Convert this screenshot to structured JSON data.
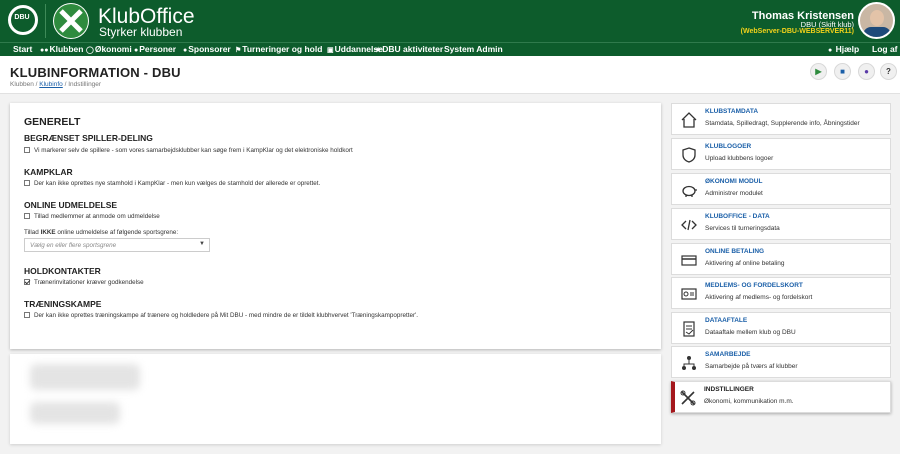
{
  "header": {
    "brand": "KlubOffice",
    "tagline": "Styrker klubben",
    "dbu_logo_text": "DBU",
    "user_name": "Thomas Kristensen",
    "user_club": "DBU (Skift klub)",
    "server": "(WebServer-DBU-WEBSERVER11)"
  },
  "nav": {
    "items": [
      {
        "label": "Start",
        "icon": ""
      },
      {
        "label": "Klubben",
        "icon": "group-icon"
      },
      {
        "label": "Økonomi",
        "icon": "coin-icon"
      },
      {
        "label": "Personer",
        "icon": "person-icon"
      },
      {
        "label": "Sponsorer",
        "icon": "sponsor-icon"
      },
      {
        "label": "Turneringer og hold",
        "icon": "flag-icon"
      },
      {
        "label": "Uddannelse",
        "icon": "book-icon"
      },
      {
        "label": "DBU aktiviteter",
        "icon": "star-icon"
      },
      {
        "label": "System Admin",
        "icon": ""
      }
    ],
    "help": "Hjælp",
    "logout": "Log af"
  },
  "page": {
    "title": "KLUBINFORMATION - DBU",
    "breadcrumb": [
      "Klubben",
      "Klubinfo",
      "Indstillinger"
    ]
  },
  "panel": {
    "title": "GENERELT",
    "sections": [
      {
        "title": "BEGRÆNSET SPILLER-DELING",
        "checkboxes": [
          {
            "label": "Vi markerer selv de spillere - som vores samarbejdsklubber kan søge frem i KampKlar og det elektroniske holdkort",
            "checked": false
          }
        ]
      },
      {
        "title": "KAMPKLAR",
        "checkboxes": [
          {
            "label": "Der kan ikke oprettes nye stamhold i KampKlar - men kun vælges de stamhold der allerede er oprettet.",
            "checked": false
          }
        ]
      },
      {
        "title": "ONLINE UDMELDELSE",
        "checkboxes": [
          {
            "label": "Tillad medlemmer at anmode om udmeldelse",
            "checked": false
          }
        ]
      },
      {
        "title": "HOLDKONTAKTER",
        "checkboxes": [
          {
            "label": "Trænerinvitationer kræver godkendelse",
            "checked": true
          }
        ]
      },
      {
        "title": "TRÆNINGSKAMPE",
        "checkboxes": [
          {
            "label": "Der kan ikke oprettes træningskampe af trænere og holdledere på Mit DBU - med mindre de er tildelt klubhvervet 'Træningskampopretter'.",
            "checked": false
          }
        ]
      }
    ],
    "sport_label_pre": "Tillad ",
    "sport_label_bold": "IKKE",
    "sport_label_post": " online udmeldelse af følgende sportsgrene:",
    "sport_placeholder": "Vælg en eller flere sportsgrene"
  },
  "cards": [
    {
      "title": "KLUBSTAMDATA",
      "desc": "Stamdata, Spilledragt, Supplerende info, Åbningstider",
      "icon": "home-icon",
      "active": false
    },
    {
      "title": "KLUBLOGOER",
      "desc": "Upload klubbens logoer",
      "icon": "shield-icon",
      "active": false
    },
    {
      "title": "ØKONOMI MODUL",
      "desc": "Administrer modulet",
      "icon": "piggy-bank-icon",
      "active": false
    },
    {
      "title": "KLUBOFFICE - DATA",
      "desc": "Services til turneringsdata",
      "icon": "code-icon",
      "active": false
    },
    {
      "title": "ONLINE BETALING",
      "desc": "Aktivering af online betaling",
      "icon": "credit-card-icon",
      "active": false
    },
    {
      "title": "MEDLEMS- OG FORDELSKORT",
      "desc": "Aktivering af medlems- og fordelskort",
      "icon": "id-card-icon",
      "active": false
    },
    {
      "title": "DATAAFTALE",
      "desc": "Dataaftale mellem klub og DBU",
      "icon": "contract-icon",
      "active": false
    },
    {
      "title": "SAMARBEJDE",
      "desc": "Samarbejde på tværs af klubber",
      "icon": "network-icon",
      "active": false
    },
    {
      "title": "INDSTILLINGER",
      "desc": "Økonomi, kommunikation m.m.",
      "icon": "tools-icon",
      "active": true
    }
  ],
  "colors": {
    "header_green": "#0d5c2c",
    "link_blue": "#1a5fa8",
    "active_red": "#a4171c",
    "server_yellow": "#f3d21a"
  }
}
